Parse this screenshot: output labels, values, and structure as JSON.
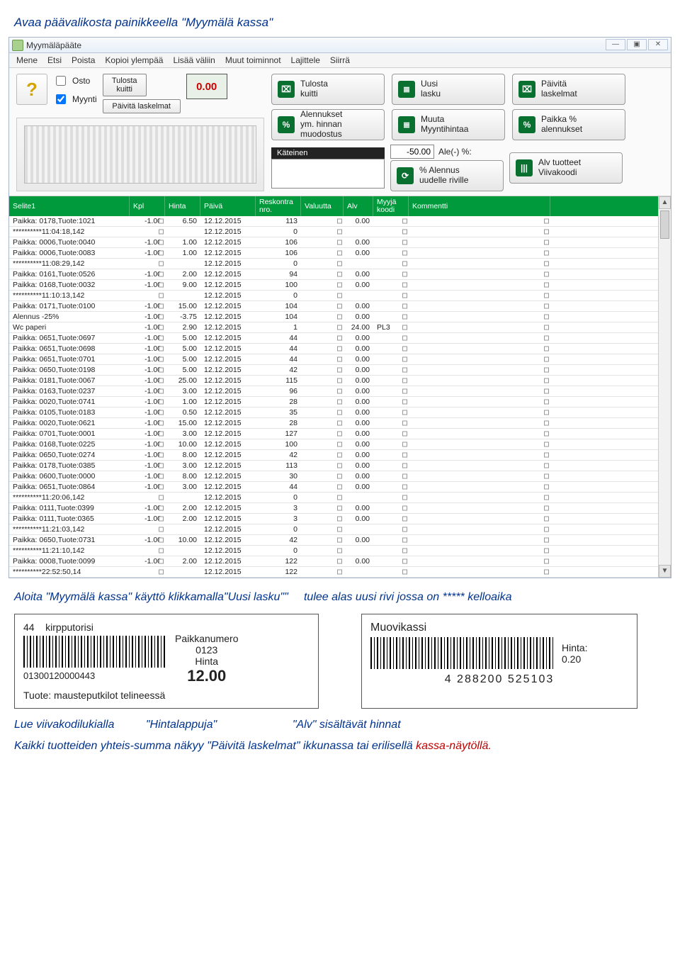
{
  "doc": {
    "top": "Avaa päävalikosta painikkeella \"Myymälä kassa\"",
    "mid_a": "Aloita \"Myymälä kassa\" käyttö klikkamalla\"Uusi lasku\"\"",
    "mid_b": "tulee alas uusi rivi jossa on ***** kelloaika",
    "line1_a": "Lue viivakodilukialla",
    "line1_b": "\"Hintalappuja\"",
    "line1_c": "\"Alv\" sisältävät hinnat",
    "line2_a": "Kaikki tuotteiden yhteis-summa näkyy \"Päivitä laskelmat\" ikkunassa tai erilisellä",
    "line2_b": "kassa-näytöllä."
  },
  "window": {
    "title": "Myymäläpääte",
    "minimize": "—",
    "restore": "▣",
    "close": "✕"
  },
  "menu": [
    "Mene",
    "Etsi",
    "Poista",
    "Kopioi ylempää",
    "Lisää väliin",
    "Muut toiminnot",
    "Lajittele",
    "Siirrä"
  ],
  "checks": {
    "osto": "Osto",
    "myynti": "Myynti"
  },
  "smallbtns": {
    "tulosta": "Tulosta\nkuitti",
    "paivita": "Päivitä laskelmat"
  },
  "display": "0.00",
  "buttons": {
    "row1": [
      {
        "label": "Tulosta\nkuitti",
        "ic": "⌧"
      },
      {
        "label": "Uusi\nlasku",
        "ic": "≣"
      },
      {
        "label": "Päivitä\nlaskelmat",
        "ic": "⌧"
      }
    ],
    "row2": [
      {
        "label": "Alennukset\nym. hinnan\nmuodostus",
        "ic": "%"
      },
      {
        "label": "Muuta\nMyyntihintaa",
        "ic": "≣"
      },
      {
        "label": "Paikka %\nalennukset",
        "ic": "%"
      }
    ],
    "row3": [
      {
        "label": "% Alennus\nuudelle riville",
        "ic": "⟳"
      },
      {
        "label": "Alv tuotteet\nViivakoodi",
        "ic": "|||"
      }
    ]
  },
  "kateinen": "Käteinen",
  "alefield": "-50.00",
  "alelabel": "Ale(-) %:",
  "columns": [
    "Selite1",
    "Kpl",
    "Hinta",
    "Päivä",
    "Reskontra\nnro.",
    "Valuutta",
    "Alv",
    "Myyjä\nkoodi",
    "Kommentti"
  ],
  "rows": [
    {
      "s": "Paikka: 0178,Tuote:1021",
      "k": "-1.00",
      "h": "6.50",
      "p": "12.12.2015",
      "r": "113",
      "v": "",
      "a": "0.00",
      "m": ""
    },
    {
      "s": "**********11:04:18,142",
      "k": "",
      "h": "",
      "p": "12.12.2015",
      "r": "0",
      "v": "",
      "a": "",
      "m": ""
    },
    {
      "s": "Paikka: 0006,Tuote:0040",
      "k": "-1.00",
      "h": "1.00",
      "p": "12.12.2015",
      "r": "106",
      "v": "",
      "a": "0.00",
      "m": ""
    },
    {
      "s": "Paikka: 0006,Tuote:0083",
      "k": "-1.00",
      "h": "1.00",
      "p": "12.12.2015",
      "r": "106",
      "v": "",
      "a": "0.00",
      "m": ""
    },
    {
      "s": "**********11:08:29,142",
      "k": "",
      "h": "",
      "p": "12.12.2015",
      "r": "0",
      "v": "",
      "a": "",
      "m": ""
    },
    {
      "s": "Paikka: 0161,Tuote:0526",
      "k": "-1.00",
      "h": "2.00",
      "p": "12.12.2015",
      "r": "94",
      "v": "",
      "a": "0.00",
      "m": ""
    },
    {
      "s": "Paikka: 0168,Tuote:0032",
      "k": "-1.00",
      "h": "9.00",
      "p": "12.12.2015",
      "r": "100",
      "v": "",
      "a": "0.00",
      "m": ""
    },
    {
      "s": "**********11:10:13,142",
      "k": "",
      "h": "",
      "p": "12.12.2015",
      "r": "0",
      "v": "",
      "a": "",
      "m": ""
    },
    {
      "s": "Paikka: 0171,Tuote:0100",
      "k": "-1.00",
      "h": "15.00",
      "p": "12.12.2015",
      "r": "104",
      "v": "",
      "a": "0.00",
      "m": ""
    },
    {
      "s": "Alennus -25%",
      "k": "-1.00",
      "h": "-3.75",
      "p": "12.12.2015",
      "r": "104",
      "v": "",
      "a": "0.00",
      "m": ""
    },
    {
      "s": "Wc paperi",
      "k": "-1.00",
      "h": "2.90",
      "p": "12.12.2015",
      "r": "1",
      "v": "",
      "a": "24.00",
      "m": "PL3"
    },
    {
      "s": "Paikka: 0651,Tuote:0697",
      "k": "-1.00",
      "h": "5.00",
      "p": "12.12.2015",
      "r": "44",
      "v": "",
      "a": "0.00",
      "m": ""
    },
    {
      "s": "Paikka: 0651,Tuote:0698",
      "k": "-1.00",
      "h": "5.00",
      "p": "12.12.2015",
      "r": "44",
      "v": "",
      "a": "0.00",
      "m": ""
    },
    {
      "s": "Paikka: 0651,Tuote:0701",
      "k": "-1.00",
      "h": "5.00",
      "p": "12.12.2015",
      "r": "44",
      "v": "",
      "a": "0.00",
      "m": ""
    },
    {
      "s": "Paikka: 0650,Tuote:0198",
      "k": "-1.00",
      "h": "5.00",
      "p": "12.12.2015",
      "r": "42",
      "v": "",
      "a": "0.00",
      "m": ""
    },
    {
      "s": "Paikka: 0181,Tuote:0067",
      "k": "-1.00",
      "h": "25.00",
      "p": "12.12.2015",
      "r": "115",
      "v": "",
      "a": "0.00",
      "m": ""
    },
    {
      "s": "Paikka: 0163,Tuote:0237",
      "k": "-1.00",
      "h": "3.00",
      "p": "12.12.2015",
      "r": "96",
      "v": "",
      "a": "0.00",
      "m": ""
    },
    {
      "s": "Paikka: 0020,Tuote:0741",
      "k": "-1.00",
      "h": "1.00",
      "p": "12.12.2015",
      "r": "28",
      "v": "",
      "a": "0.00",
      "m": ""
    },
    {
      "s": "Paikka: 0105,Tuote:0183",
      "k": "-1.00",
      "h": "0.50",
      "p": "12.12.2015",
      "r": "35",
      "v": "",
      "a": "0.00",
      "m": ""
    },
    {
      "s": "Paikka: 0020,Tuote:0621",
      "k": "-1.00",
      "h": "15.00",
      "p": "12.12.2015",
      "r": "28",
      "v": "",
      "a": "0.00",
      "m": ""
    },
    {
      "s": "Paikka: 0701,Tuote:0001",
      "k": "-1.00",
      "h": "3.00",
      "p": "12.12.2015",
      "r": "127",
      "v": "",
      "a": "0.00",
      "m": ""
    },
    {
      "s": "Paikka: 0168,Tuote:0225",
      "k": "-1.00",
      "h": "10.00",
      "p": "12.12.2015",
      "r": "100",
      "v": "",
      "a": "0.00",
      "m": ""
    },
    {
      "s": "Paikka: 0650,Tuote:0274",
      "k": "-1.00",
      "h": "8.00",
      "p": "12.12.2015",
      "r": "42",
      "v": "",
      "a": "0.00",
      "m": ""
    },
    {
      "s": "Paikka: 0178,Tuote:0385",
      "k": "-1.00",
      "h": "3.00",
      "p": "12.12.2015",
      "r": "113",
      "v": "",
      "a": "0.00",
      "m": ""
    },
    {
      "s": "Paikka: 0600,Tuote:0000",
      "k": "-1.00",
      "h": "8.00",
      "p": "12.12.2015",
      "r": "30",
      "v": "",
      "a": "0.00",
      "m": ""
    },
    {
      "s": "Paikka: 0651,Tuote:0864",
      "k": "-1.00",
      "h": "3.00",
      "p": "12.12.2015",
      "r": "44",
      "v": "",
      "a": "0.00",
      "m": ""
    },
    {
      "s": "**********11:20:06,142",
      "k": "",
      "h": "",
      "p": "12.12.2015",
      "r": "0",
      "v": "",
      "a": "",
      "m": ""
    },
    {
      "s": "Paikka: 0111,Tuote:0399",
      "k": "-1.00",
      "h": "2.00",
      "p": "12.12.2015",
      "r": "3",
      "v": "",
      "a": "0.00",
      "m": ""
    },
    {
      "s": "Paikka: 0111,Tuote:0365",
      "k": "-1.00",
      "h": "2.00",
      "p": "12.12.2015",
      "r": "3",
      "v": "",
      "a": "0.00",
      "m": ""
    },
    {
      "s": "**********11:21:03,142",
      "k": "",
      "h": "",
      "p": "12.12.2015",
      "r": "0",
      "v": "",
      "a": "",
      "m": ""
    },
    {
      "s": "Paikka: 0650,Tuote:0731",
      "k": "-1.00",
      "h": "10.00",
      "p": "12.12.2015",
      "r": "42",
      "v": "",
      "a": "0.00",
      "m": ""
    },
    {
      "s": "**********11:21:10,142",
      "k": "",
      "h": "",
      "p": "12.12.2015",
      "r": "0",
      "v": "",
      "a": "",
      "m": ""
    },
    {
      "s": "Paikka: 0008,Tuote:0099",
      "k": "-1.00",
      "h": "2.00",
      "p": "12.12.2015",
      "r": "122",
      "v": "",
      "a": "0.00",
      "m": ""
    },
    {
      "s": "**********22:52:50,14",
      "k": "",
      "h": "",
      "p": "12.12.2015",
      "r": "122",
      "v": "",
      "a": "",
      "m": ""
    }
  ],
  "barcode_left": {
    "top_num": "44",
    "top_txt": "kirpputorisi",
    "code": "01300120000443",
    "paikka_lbl": "Paikkanumero",
    "paikka_val": "0123",
    "hinta_lbl": "Hinta",
    "hinta_val": "12.00",
    "bottom": "Tuote: mausteputkilot telineessä"
  },
  "barcode_right": {
    "title": "Muovikassi",
    "hinta_lbl": "Hinta:",
    "hinta_val": "0.20",
    "code": "4 288200 525103"
  }
}
